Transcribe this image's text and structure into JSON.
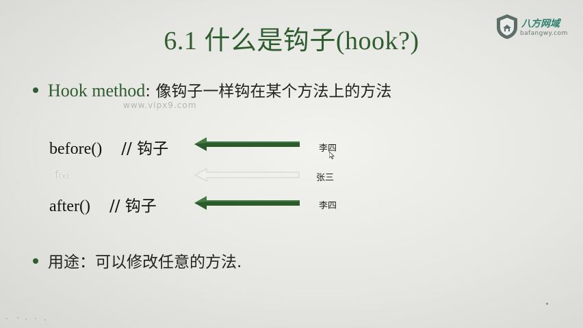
{
  "title": "6.1 什么是钩子(hook?)",
  "logo": {
    "brand_cn": "八方网域",
    "url": "bafangwy.com",
    "icon": "shield-icon",
    "color": "#2e7f6e"
  },
  "bullets": {
    "hook_term": "Hook method",
    "hook_desc": ": 像钩子一样钩在某个方法上的方法",
    "usage": "用途：可以修改任意的方法."
  },
  "watermark": "www.vipx9.com",
  "code_rows": {
    "before": {
      "code": "before()",
      "comment": "// 钩子"
    },
    "middle": {
      "label": "f",
      "arg": "(x)"
    },
    "after": {
      "code": "after()",
      "comment": "// 钩子"
    }
  },
  "names": {
    "before": "李四",
    "middle": "张三",
    "after": "李四"
  },
  "colors": {
    "accent_green": "#2f5d2f",
    "arrow_dark": "#2b5a2b",
    "arrow_faded": "#d8dcd6"
  }
}
